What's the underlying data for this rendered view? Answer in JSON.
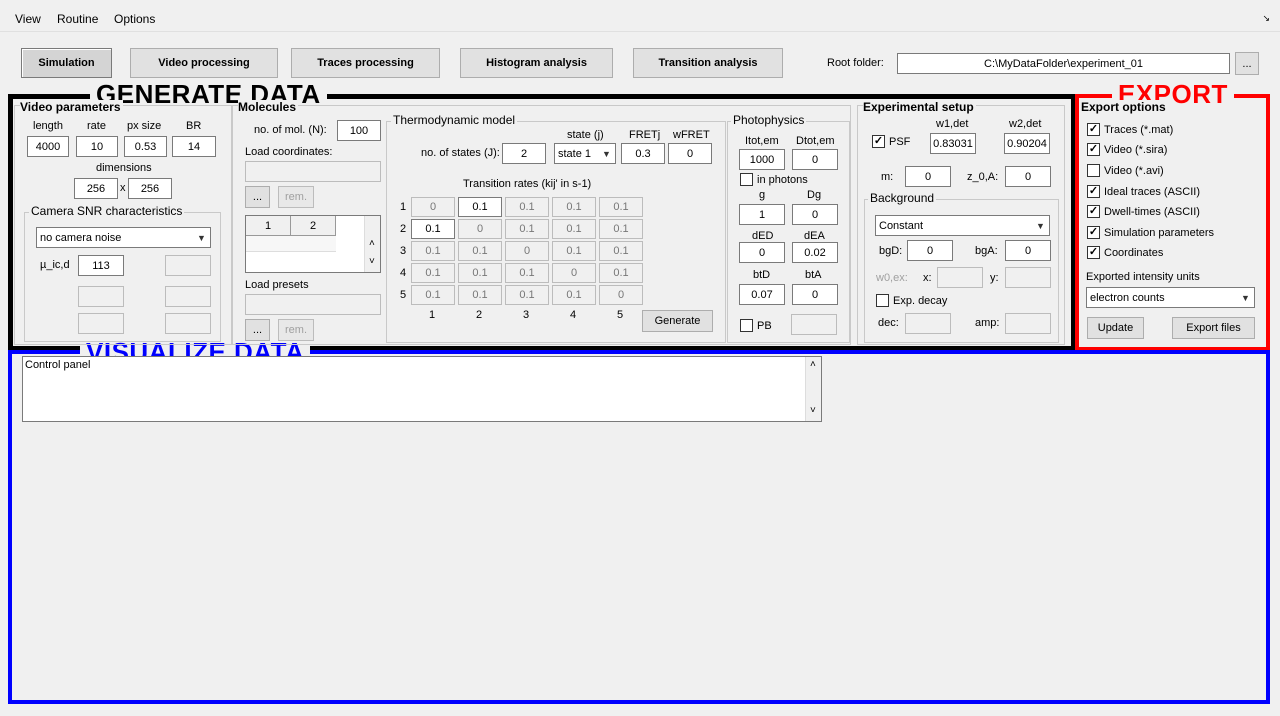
{
  "menu": [
    "View",
    "Routine",
    "Options"
  ],
  "tabs": {
    "simulation": "Simulation",
    "video": "Video processing",
    "traces": "Traces processing",
    "histogram": "Histogram analysis",
    "transition": "Transition analysis"
  },
  "root": {
    "label": "Root folder:",
    "path": "C:\\MyDataFolder\\experiment_01",
    "browse": "..."
  },
  "sections": {
    "generate": "GENERATE DATA",
    "export": "EXPORT",
    "visualize": "VISUALIZE DATA"
  },
  "video_params": {
    "title": "Video parameters",
    "h_length": "length",
    "h_rate": "rate",
    "h_px": "px size",
    "h_br": "BR",
    "length": "4000",
    "rate": "10",
    "px": "0.53",
    "br": "14",
    "h_dim": "dimensions",
    "dim_x": "256",
    "x": "x",
    "dim_y": "256",
    "camera": {
      "title": "Camera SNR characteristics",
      "noise": "no camera noise",
      "mu_label": "µ_ic,d",
      "mu": "113"
    }
  },
  "molecules": {
    "title": "Molecules",
    "n_label": "no. of mol. (N):",
    "n": "100",
    "load_coords": "Load coordinates:",
    "browse": "...",
    "rem": "rem.",
    "table_cols": [
      "1",
      "2"
    ],
    "load_presets": "Load presets"
  },
  "thermo": {
    "title": "Thermodynamic model",
    "state_j": "state (j)",
    "fretj": "FRETj",
    "wfret": "wFRET",
    "n_states_label": "no. of states (J):",
    "n_states": "2",
    "state_sel": "state 1",
    "fret": "0.3",
    "wfret_val": "0",
    "rates_title": "Transition rates (kij' in s-1)",
    "row_labels": [
      "1",
      "2",
      "3",
      "4",
      "5"
    ],
    "col_labels": [
      "1",
      "2",
      "3",
      "4",
      "5"
    ],
    "rates": [
      [
        "0",
        "0.1",
        "0.1",
        "0.1",
        "0.1"
      ],
      [
        "0.1",
        "0",
        "0.1",
        "0.1",
        "0.1"
      ],
      [
        "0.1",
        "0.1",
        "0",
        "0.1",
        "0.1"
      ],
      [
        "0.1",
        "0.1",
        "0.1",
        "0",
        "0.1"
      ],
      [
        "0.1",
        "0.1",
        "0.1",
        "0.1",
        "0"
      ]
    ],
    "generate": "Generate"
  },
  "photo": {
    "title": "Photophysics",
    "itot_label": "Itot,em",
    "dtot_label": "Dtot,em",
    "itot": "1000",
    "dtot": "0",
    "in_photons": "in photons",
    "g_label": "g",
    "dg_label": "Dg",
    "g": "1",
    "dg": "0",
    "ded_label": "dED",
    "dea_label": "dEA",
    "ded": "0",
    "dea": "0.02",
    "btd_label": "btD",
    "bta_label": "btA",
    "btd": "0.07",
    "bta": "0",
    "pb": "PB"
  },
  "exp": {
    "title": "Experimental setup",
    "w1_label": "w1,det",
    "w2_label": "w2,det",
    "psf": "PSF",
    "w1": "0.83031",
    "w2": "0.90204",
    "m_label": "m:",
    "m": "0",
    "z_label": "z_0,A:",
    "z": "0",
    "bg": {
      "title": "Background",
      "type": "Constant",
      "bgd_label": "bgD:",
      "bgd": "0",
      "bga_label": "bgA:",
      "bga": "0",
      "w0_label": "w0,ex:",
      "x_label": "x:",
      "y_label": "y:",
      "exp_decay": "Exp. decay",
      "dec_label": "dec:",
      "amp_label": "amp:"
    }
  },
  "export": {
    "title": "Export options",
    "options": [
      {
        "label": "Traces (*.mat)",
        "checked": true
      },
      {
        "label": "Video (*.sira)",
        "checked": true
      },
      {
        "label": "Video (*.avi)",
        "checked": false
      },
      {
        "label": "Ideal traces (ASCII)",
        "checked": true
      },
      {
        "label": "Dwell-times (ASCII)",
        "checked": true
      },
      {
        "label": "Simulation parameters",
        "checked": true
      },
      {
        "label": "Coordinates",
        "checked": true
      }
    ],
    "units_label": "Exported intensity units",
    "units": "electron counts",
    "update": "Update",
    "export_files": "Export files"
  },
  "control_panel": "Control panel",
  "colors": {
    "generate": "#000000",
    "export": "#ff0000",
    "visualize": "#0000ff"
  }
}
